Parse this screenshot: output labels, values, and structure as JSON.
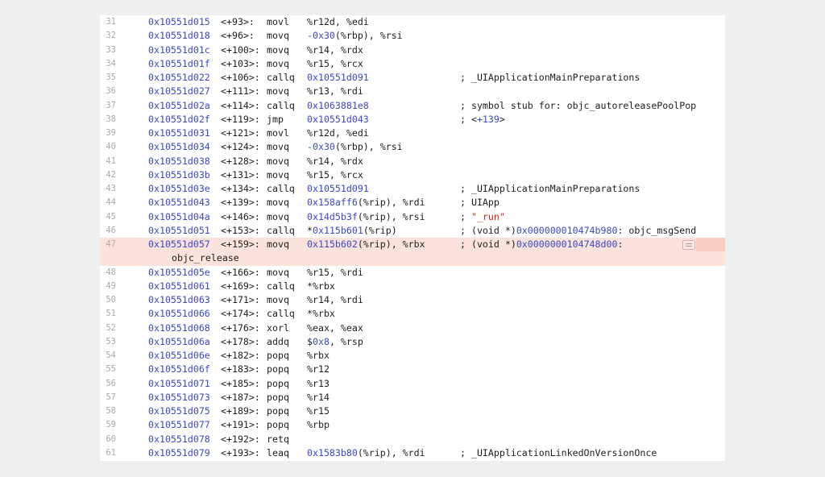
{
  "rows": [
    {
      "ln": "31",
      "addr": "0x10551d015",
      "off": "<+93>:",
      "mn": "movl",
      "ops": [
        {
          "t": "%r12d, %edi",
          "c": ""
        }
      ],
      "cmt": []
    },
    {
      "ln": "32",
      "addr": "0x10551d018",
      "off": "<+96>:",
      "mn": "movq",
      "ops": [
        {
          "t": "-0x30",
          "c": "num"
        },
        {
          "t": "(%rbp), %rsi",
          "c": ""
        }
      ],
      "cmt": []
    },
    {
      "ln": "33",
      "addr": "0x10551d01c",
      "off": "<+100>:",
      "mn": "movq",
      "ops": [
        {
          "t": "%r14, %rdx",
          "c": ""
        }
      ],
      "cmt": []
    },
    {
      "ln": "34",
      "addr": "0x10551d01f",
      "off": "<+103>:",
      "mn": "movq",
      "ops": [
        {
          "t": "%r15, %rcx",
          "c": ""
        }
      ],
      "cmt": []
    },
    {
      "ln": "35",
      "addr": "0x10551d022",
      "off": "<+106>:",
      "mn": "callq",
      "ops": [
        {
          "t": "0x10551d091",
          "c": "num"
        }
      ],
      "cmt": [
        {
          "t": "; _UIApplicationMainPreparations",
          "c": ""
        }
      ]
    },
    {
      "ln": "36",
      "addr": "0x10551d027",
      "off": "<+111>:",
      "mn": "movq",
      "ops": [
        {
          "t": "%r13, %rdi",
          "c": ""
        }
      ],
      "cmt": []
    },
    {
      "ln": "37",
      "addr": "0x10551d02a",
      "off": "<+114>:",
      "mn": "callq",
      "ops": [
        {
          "t": "0x1063881e8",
          "c": "num"
        }
      ],
      "cmt": [
        {
          "t": "; symbol stub for: objc_autoreleasePoolPop",
          "c": ""
        }
      ]
    },
    {
      "ln": "38",
      "addr": "0x10551d02f",
      "off": "<+119>:",
      "mn": "jmp",
      "ops": [
        {
          "t": "0x10551d043",
          "c": "num"
        }
      ],
      "cmt": [
        {
          "t": "; <",
          "c": ""
        },
        {
          "t": "+139",
          "c": "num"
        },
        {
          "t": ">",
          "c": ""
        }
      ]
    },
    {
      "ln": "39",
      "addr": "0x10551d031",
      "off": "<+121>:",
      "mn": "movl",
      "ops": [
        {
          "t": "%r12d, %edi",
          "c": ""
        }
      ],
      "cmt": []
    },
    {
      "ln": "40",
      "addr": "0x10551d034",
      "off": "<+124>:",
      "mn": "movq",
      "ops": [
        {
          "t": "-0x30",
          "c": "num"
        },
        {
          "t": "(%rbp), %rsi",
          "c": ""
        }
      ],
      "cmt": []
    },
    {
      "ln": "41",
      "addr": "0x10551d038",
      "off": "<+128>:",
      "mn": "movq",
      "ops": [
        {
          "t": "%r14, %rdx",
          "c": ""
        }
      ],
      "cmt": []
    },
    {
      "ln": "42",
      "addr": "0x10551d03b",
      "off": "<+131>:",
      "mn": "movq",
      "ops": [
        {
          "t": "%r15, %rcx",
          "c": ""
        }
      ],
      "cmt": []
    },
    {
      "ln": "43",
      "addr": "0x10551d03e",
      "off": "<+134>:",
      "mn": "callq",
      "ops": [
        {
          "t": "0x10551d091",
          "c": "num"
        }
      ],
      "cmt": [
        {
          "t": "; _UIApplicationMainPreparations",
          "c": ""
        }
      ]
    },
    {
      "ln": "44",
      "addr": "0x10551d043",
      "off": "<+139>:",
      "mn": "movq",
      "ops": [
        {
          "t": "0x158aff6",
          "c": "num"
        },
        {
          "t": "(%rip), %rdi",
          "c": ""
        }
      ],
      "cmt": [
        {
          "t": "; UIApp",
          "c": ""
        }
      ]
    },
    {
      "ln": "45",
      "addr": "0x10551d04a",
      "off": "<+146>:",
      "mn": "movq",
      "ops": [
        {
          "t": "0x14d5b3f",
          "c": "num"
        },
        {
          "t": "(%rip), %rsi",
          "c": ""
        }
      ],
      "cmt": [
        {
          "t": "; ",
          "c": ""
        },
        {
          "t": "\"_run\"",
          "c": "str"
        }
      ]
    },
    {
      "ln": "46",
      "addr": "0x10551d051",
      "off": "<+153>:",
      "mn": "callq",
      "ops": [
        {
          "t": "*",
          "c": ""
        },
        {
          "t": "0x115b601",
          "c": "num"
        },
        {
          "t": "(%rip)",
          "c": ""
        }
      ],
      "cmt": [
        {
          "t": "; (void *)",
          "c": ""
        },
        {
          "t": "0x000000010474b980",
          "c": "num"
        },
        {
          "t": ": objc_msgSend",
          "c": ""
        }
      ]
    },
    {
      "ln": "47",
      "addr": "0x10551d057",
      "off": "<+159>:",
      "mn": "movq",
      "ops": [
        {
          "t": "0x115b602",
          "c": "num"
        },
        {
          "t": "(%rip), %rbx",
          "c": ""
        }
      ],
      "cmt": [
        {
          "t": "; (void *)",
          "c": ""
        },
        {
          "t": "0x0000000104748d00",
          "c": "num"
        },
        {
          "t": ":",
          "c": ""
        }
      ],
      "cont": "objc_release",
      "hl": true
    },
    {
      "ln": "48",
      "addr": "0x10551d05e",
      "off": "<+166>:",
      "mn": "movq",
      "ops": [
        {
          "t": "%r15, %rdi",
          "c": ""
        }
      ],
      "cmt": []
    },
    {
      "ln": "49",
      "addr": "0x10551d061",
      "off": "<+169>:",
      "mn": "callq",
      "ops": [
        {
          "t": "*%rbx",
          "c": ""
        }
      ],
      "cmt": []
    },
    {
      "ln": "50",
      "addr": "0x10551d063",
      "off": "<+171>:",
      "mn": "movq",
      "ops": [
        {
          "t": "%r14, %rdi",
          "c": ""
        }
      ],
      "cmt": []
    },
    {
      "ln": "51",
      "addr": "0x10551d066",
      "off": "<+174>:",
      "mn": "callq",
      "ops": [
        {
          "t": "*%rbx",
          "c": ""
        }
      ],
      "cmt": []
    },
    {
      "ln": "52",
      "addr": "0x10551d068",
      "off": "<+176>:",
      "mn": "xorl",
      "ops": [
        {
          "t": "%eax, %eax",
          "c": ""
        }
      ],
      "cmt": []
    },
    {
      "ln": "53",
      "addr": "0x10551d06a",
      "off": "<+178>:",
      "mn": "addq",
      "ops": [
        {
          "t": "$",
          "c": ""
        },
        {
          "t": "0x8",
          "c": "num"
        },
        {
          "t": ", %rsp",
          "c": ""
        }
      ],
      "cmt": []
    },
    {
      "ln": "54",
      "addr": "0x10551d06e",
      "off": "<+182>:",
      "mn": "popq",
      "ops": [
        {
          "t": "%rbx",
          "c": ""
        }
      ],
      "cmt": []
    },
    {
      "ln": "55",
      "addr": "0x10551d06f",
      "off": "<+183>:",
      "mn": "popq",
      "ops": [
        {
          "t": "%r12",
          "c": ""
        }
      ],
      "cmt": []
    },
    {
      "ln": "56",
      "addr": "0x10551d071",
      "off": "<+185>:",
      "mn": "popq",
      "ops": [
        {
          "t": "%r13",
          "c": ""
        }
      ],
      "cmt": []
    },
    {
      "ln": "57",
      "addr": "0x10551d073",
      "off": "<+187>:",
      "mn": "popq",
      "ops": [
        {
          "t": "%r14",
          "c": ""
        }
      ],
      "cmt": []
    },
    {
      "ln": "58",
      "addr": "0x10551d075",
      "off": "<+189>:",
      "mn": "popq",
      "ops": [
        {
          "t": "%r15",
          "c": ""
        }
      ],
      "cmt": []
    },
    {
      "ln": "59",
      "addr": "0x10551d077",
      "off": "<+191>:",
      "mn": "popq",
      "ops": [
        {
          "t": "%rbp",
          "c": ""
        }
      ],
      "cmt": []
    },
    {
      "ln": "60",
      "addr": "0x10551d078",
      "off": "<+192>:",
      "mn": "retq",
      "ops": [],
      "cmt": []
    },
    {
      "ln": "61",
      "addr": "0x10551d079",
      "off": "<+193>:",
      "mn": "leaq",
      "ops": [
        {
          "t": "0x1583b80",
          "c": "num"
        },
        {
          "t": "(%rip), %rdi",
          "c": ""
        }
      ],
      "cmt": [
        {
          "t": "; _UIApplicationLinkedOnVersionOnce",
          "c": ""
        }
      ]
    }
  ],
  "highlight_line": "47",
  "colors": {
    "address": "#3b47c6",
    "string": "#c8291f",
    "highlight": "#fbe2dc",
    "line_number": "#a9a9a9"
  },
  "icons": {
    "highlight_row_button": "annotation-lines-icon"
  }
}
